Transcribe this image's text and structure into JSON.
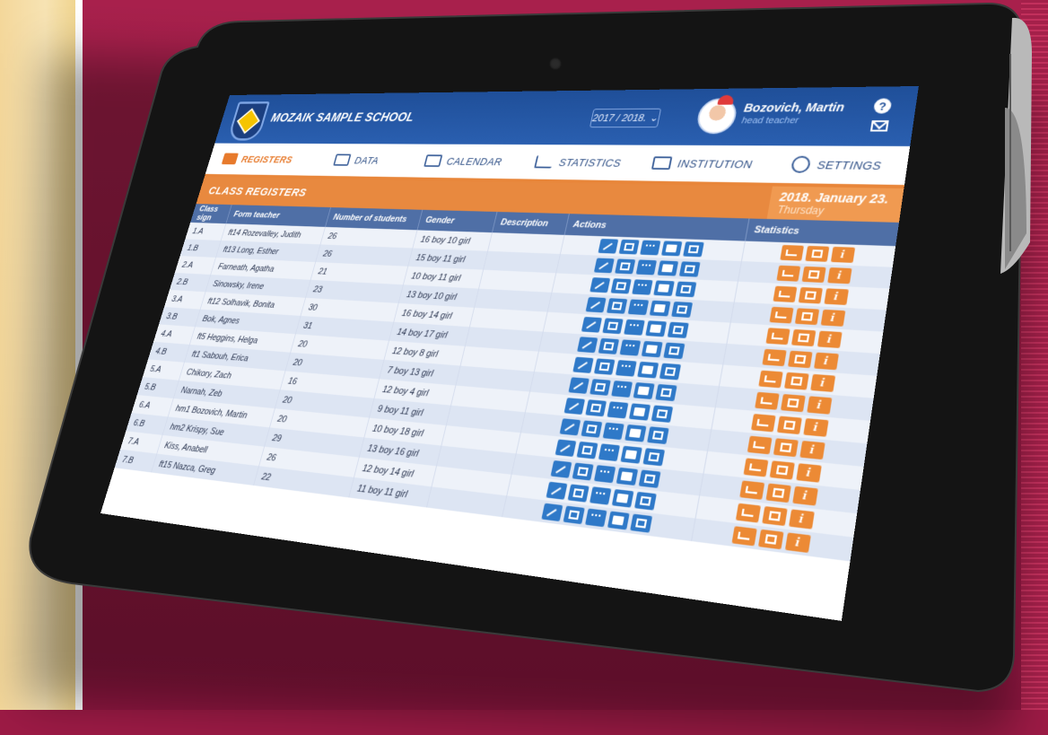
{
  "school": {
    "name": "MOZAIK SAMPLE SCHOOL"
  },
  "year_select": {
    "value": "2017 / 2018."
  },
  "user": {
    "name": "Bozovich, Martin",
    "role": "head teacher"
  },
  "nav": [
    {
      "label": "REGISTERS",
      "icon": "registers-icon",
      "active": true
    },
    {
      "label": "DATA",
      "icon": "data-icon"
    },
    {
      "label": "CALENDAR",
      "icon": "calendar-icon"
    },
    {
      "label": "STATISTICS",
      "icon": "statistics-icon"
    },
    {
      "label": "INSTITUTION",
      "icon": "institution-icon"
    },
    {
      "label": "SETTINGS",
      "icon": "settings-icon"
    }
  ],
  "section": {
    "title": "CLASS REGISTERS",
    "date": "2018. January 23.",
    "day": "Thursday"
  },
  "table": {
    "headers": [
      "Class sign",
      "Form teacher",
      "Number of students",
      "Gender",
      "Description",
      "Actions",
      "Statistics"
    ],
    "rows": [
      {
        "class": "1.A",
        "teacher": "ft14 Rozevalley, Judith",
        "students": "26",
        "gender": "16 boy 10 girl"
      },
      {
        "class": "1.B",
        "teacher": "ft13 Long, Esther",
        "students": "26",
        "gender": "15 boy 11 girl"
      },
      {
        "class": "2.A",
        "teacher": "Farneath, Agatha",
        "students": "21",
        "gender": "10 boy 11 girl"
      },
      {
        "class": "2.B",
        "teacher": "Sinowsky, Irene",
        "students": "23",
        "gender": "13 boy 10 girl"
      },
      {
        "class": "3.A",
        "teacher": "ft12 Solhavik, Bonita",
        "students": "30",
        "gender": "16 boy 14 girl"
      },
      {
        "class": "3.B",
        "teacher": "Bok, Agnes",
        "students": "31",
        "gender": "14 boy 17 girl"
      },
      {
        "class": "4.A",
        "teacher": "ft5 Heggins, Helga",
        "students": "20",
        "gender": "12 boy 8 girl"
      },
      {
        "class": "4.B",
        "teacher": "ft1 Sabouh, Erica",
        "students": "20",
        "gender": "7 boy 13 girl"
      },
      {
        "class": "5.A",
        "teacher": "Chikory, Zach",
        "students": "16",
        "gender": "12 boy 4 girl"
      },
      {
        "class": "5.B",
        "teacher": "Narnah, Zeb",
        "students": "20",
        "gender": "9 boy 11 girl"
      },
      {
        "class": "6.A",
        "teacher": "hm1 Bozovich, Martin",
        "students": "20",
        "gender": "10 boy 18 girl"
      },
      {
        "class": "6.B",
        "teacher": "hm2 Krispy, Sue",
        "students": "29",
        "gender": "13 boy 16 girl"
      },
      {
        "class": "7.A",
        "teacher": "Kiss, Anabell",
        "students": "26",
        "gender": "12 boy 14 girl"
      },
      {
        "class": "7.B",
        "teacher": "ft15 Nazca, Greg",
        "students": "22",
        "gender": "11 boy 11 girl"
      }
    ]
  },
  "colors": {
    "header_blue": "#1f4f99",
    "accent_orange": "#e8893f",
    "action_blue": "#2f79c8",
    "stat_orange": "#ec8a35",
    "background_maroon": "#9c1a45"
  }
}
